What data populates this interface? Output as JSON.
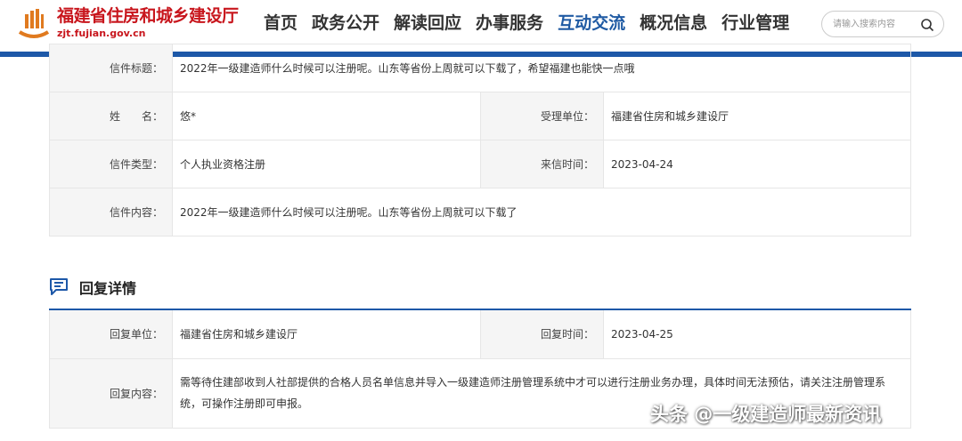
{
  "header": {
    "logo_title": "福建省住房和城乡建设厅",
    "logo_domain": "zjt.fujian.gov.cn",
    "nav": [
      {
        "label": "首页",
        "active": false
      },
      {
        "label": "政务公开",
        "active": false
      },
      {
        "label": "解读回应",
        "active": false
      },
      {
        "label": "办事服务",
        "active": false
      },
      {
        "label": "互动交流",
        "active": true
      },
      {
        "label": "概况信息",
        "active": false
      },
      {
        "label": "行业管理",
        "active": false
      }
    ],
    "search_placeholder": "请输入搜索内容"
  },
  "letter": {
    "title_label": "信件标题：",
    "title_value": "2022年一级建造师什么时候可以注册呢。山东等省份上周就可以下载了，希望福建也能快一点哦",
    "name_label": "姓　　名：",
    "name_value": "悠*",
    "dept_label": "受理单位：",
    "dept_value": "福建省住房和城乡建设厅",
    "type_label": "信件类型：",
    "type_value": "个人执业资格注册",
    "date_label": "来信时间：",
    "date_value": "2023-04-24",
    "content_label": "信件内容：",
    "content_value": "2022年一级建造师什么时候可以注册呢。山东等省份上周就可以下载了"
  },
  "reply": {
    "section_title": "回复详情",
    "unit_label": "回复单位：",
    "unit_value": "福建省住房和城乡建设厅",
    "date_label": "回复时间：",
    "date_value": "2023-04-25",
    "content_label": "回复内容：",
    "content_value": "需等待住建部收到人社部提供的合格人员名单信息并导入一级建造师注册管理系统中才可以进行注册业务办理，具体时间无法预估，请关注注册管理系统，可操作注册即可申报。"
  },
  "watermark": "头条 @一级建造师最新资讯",
  "colors": {
    "brand_red": "#c8161d",
    "brand_blue": "#1d58a8",
    "label_bg": "#f5f5f5"
  }
}
